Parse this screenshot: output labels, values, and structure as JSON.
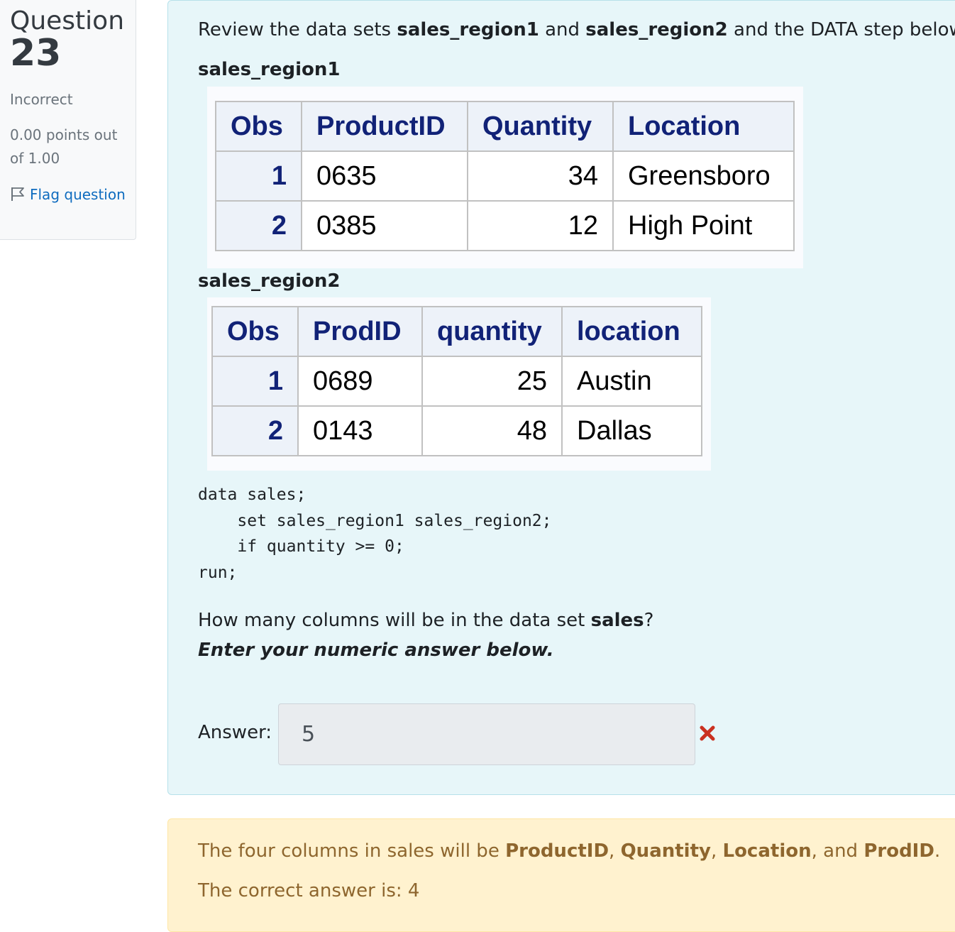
{
  "info": {
    "question_word": "Question",
    "question_number": "23",
    "state": "Incorrect",
    "grade": "0.00 points out of 1.00",
    "flag_label": "Flag question"
  },
  "question": {
    "intro_parts": [
      "Review the data sets ",
      "sales_region1",
      " and ",
      "sales_region2",
      " and the DATA step below."
    ],
    "table1": {
      "name": "sales_region1",
      "headers": [
        "Obs",
        "ProductID",
        "Quantity",
        "Location"
      ],
      "rows": [
        [
          "1",
          "0635",
          "34",
          "Greensboro"
        ],
        [
          "2",
          "0385",
          "12",
          "High Point"
        ]
      ]
    },
    "table2": {
      "name": "sales_region2",
      "headers": [
        "Obs",
        "ProdID",
        "quantity",
        "location"
      ],
      "rows": [
        [
          "1",
          "0689",
          "25",
          "Austin"
        ],
        [
          "2",
          "0143",
          "48",
          "Dallas"
        ]
      ]
    },
    "code_lines": [
      "data sales;",
      "    set sales_region1 sales_region2;",
      "    if quantity >= 0;",
      "run;"
    ],
    "prompt_parts": [
      "How many columns will be in the data set ",
      "sales",
      "?"
    ],
    "emphasis": "Enter your numeric answer below.",
    "answer_label": "Answer:",
    "answer_value": "5",
    "answer_status_icon": "incorrect-cross-icon"
  },
  "feedback": {
    "explanation_parts": [
      "The four columns in sales will be ",
      "ProductID",
      ", ",
      "Quantity",
      ", ",
      "Location",
      ", and ",
      "ProdID",
      "."
    ],
    "correct_answer": "The correct answer is: 4"
  },
  "colors": {
    "link": "#0f6cbf",
    "incorrect": "#ca3120",
    "formulation_bg": "#e7f6f9",
    "feedback_bg": "#fff2cf",
    "sas_header_text": "#112277"
  }
}
